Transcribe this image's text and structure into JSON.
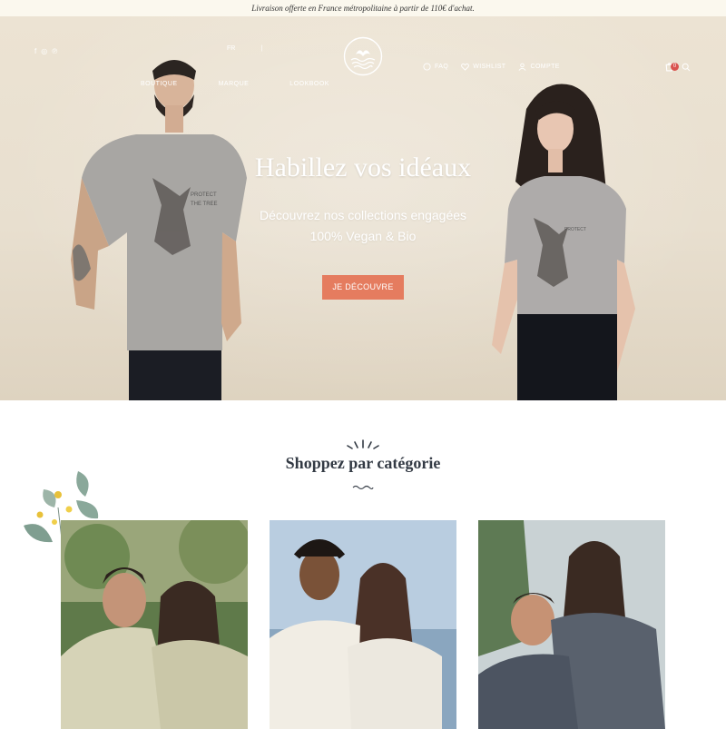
{
  "announcement": "Livraison offerte en France métropolitaine à partir de 110€ d'achat.",
  "header": {
    "social_icons": [
      "facebook-icon",
      "instagram-icon",
      "pinterest-icon"
    ],
    "social_glyphs": [
      "f",
      "◎",
      "℗"
    ],
    "lang_primary": "FR",
    "lang_separator": "|",
    "nav": [
      "BOUTIQUE",
      "MARQUE",
      "LOOKBOOK"
    ],
    "utility": [
      "FAQ",
      "WISHLIST",
      "COMPTE"
    ],
    "cart_count": "0"
  },
  "hero": {
    "title": "Habillez vos idéaux",
    "subtitle_line1": "Découvrez nos collections engagées",
    "subtitle_line2": "100% Vegan & Bio",
    "cta": "JE DÉCOUVRE"
  },
  "categories": {
    "title": "Shoppez par catégorie"
  },
  "colors": {
    "accent": "#e57c5f",
    "hero_bg": "#e8dfcf",
    "title": "#333a44",
    "badge": "#d9534f"
  }
}
